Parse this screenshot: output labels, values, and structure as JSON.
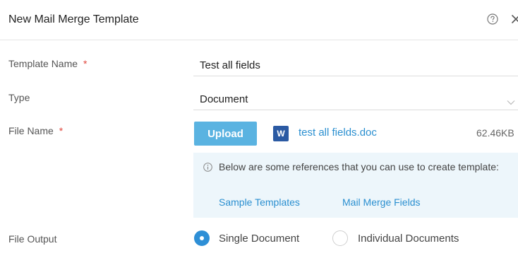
{
  "dialog": {
    "title": "New Mail Merge Template"
  },
  "form": {
    "template_name": {
      "label": "Template Name",
      "required_mark": "*",
      "value": "Test all fields"
    },
    "type": {
      "label": "Type",
      "value": "Document"
    },
    "file_name": {
      "label": "File Name",
      "required_mark": "*",
      "upload_label": "Upload",
      "file_badge": "W",
      "file_link": "test all fields.doc",
      "file_size": "62.46KB"
    },
    "info": {
      "text": "Below are some references that you can use to create template:",
      "link_sample": "Sample Templates",
      "link_fields": "Mail Merge Fields"
    },
    "file_output": {
      "label": "File Output",
      "options": [
        {
          "label": "Single Document",
          "selected": true
        },
        {
          "label": "Individual Documents",
          "selected": false
        }
      ]
    }
  },
  "colors": {
    "accent": "#2e8fd6",
    "upload_button": "#5ab3e1",
    "link": "#2a8fd0",
    "required": "#e0443a",
    "word_icon": "#2b5aa3",
    "info_background": "#edf6fb"
  },
  "icons": {
    "help": "question-circle-icon",
    "close": "close-icon",
    "dropdown": "chevron-down-icon",
    "file": "word-document-icon",
    "info": "info-circle-icon"
  }
}
